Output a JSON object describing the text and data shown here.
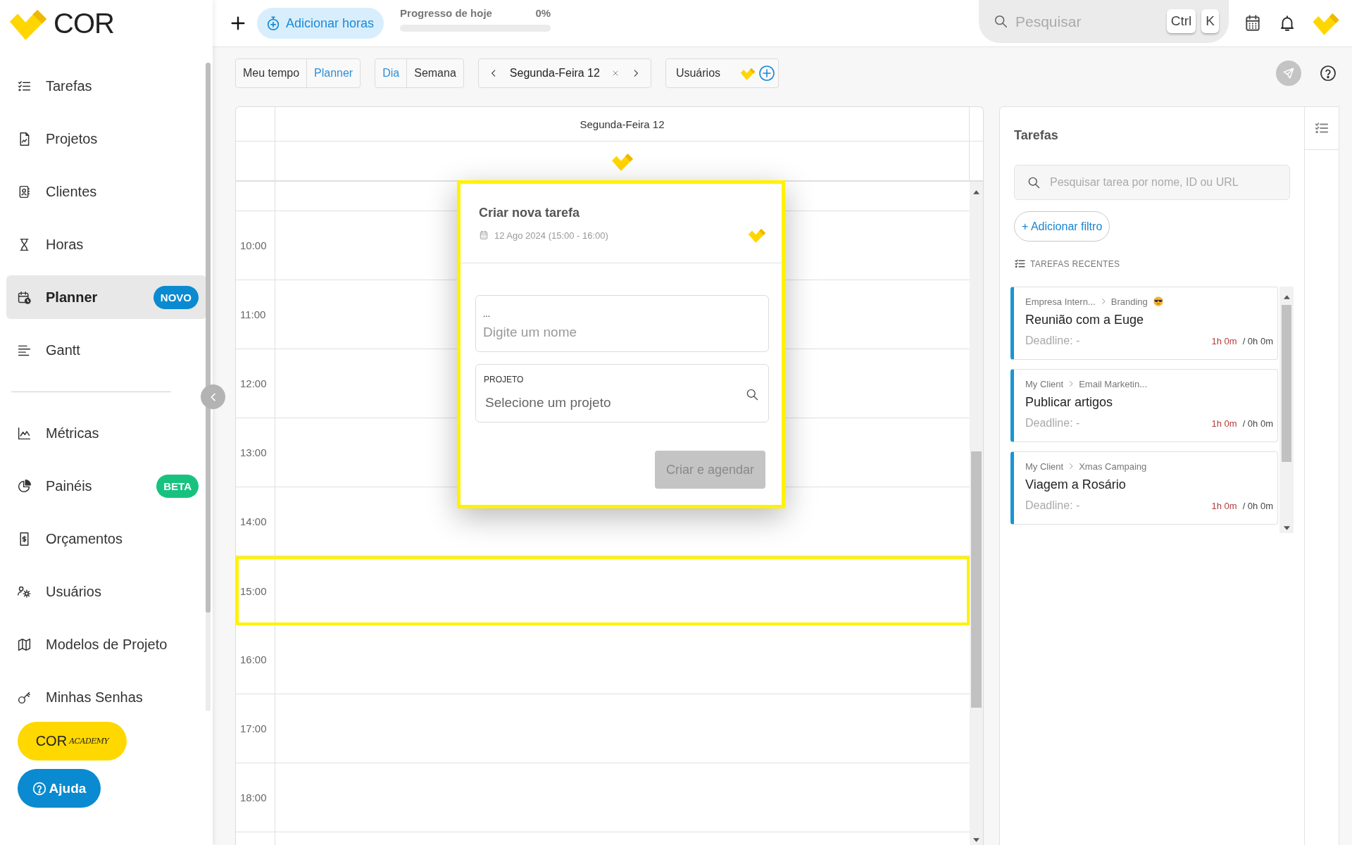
{
  "sidebar": {
    "brand": "COR",
    "nav_groups": [
      {
        "items": [
          {
            "label": "Tarefas",
            "selected": false
          },
          {
            "label": "Projetos",
            "selected": false
          },
          {
            "label": "Clientes",
            "selected": false
          },
          {
            "label": "Horas",
            "selected": false
          },
          {
            "label": "Planner",
            "selected": true,
            "badge": {
              "text": "NOVO",
              "color": "#0a8ad0"
            }
          },
          {
            "label": "Gantt",
            "selected": false
          }
        ]
      },
      {
        "items": [
          {
            "label": "Métricas",
            "selected": false
          },
          {
            "label": "Painéis",
            "selected": false,
            "badge": {
              "text": "BETA",
              "color": "#17c27f"
            }
          },
          {
            "label": "Orçamentos",
            "selected": false
          },
          {
            "label": "Usuários",
            "selected": false
          },
          {
            "label": "Modelos de Projeto",
            "selected": false
          },
          {
            "label": "Minhas Senhas",
            "selected": false
          }
        ]
      }
    ],
    "academy_button": {
      "brand": "COR",
      "word": "ACADEMY"
    },
    "help_button": {
      "label": "Ajuda"
    }
  },
  "top_bar": {
    "add_hours_button": {
      "label": "Adicionar horas"
    },
    "progress": {
      "label": "Progresso de hoje",
      "reading": "0%",
      "level": 0
    },
    "search": {
      "placeholder": "Pesquisar",
      "shortcut_keys": [
        "Ctrl",
        "K"
      ]
    }
  },
  "toolbar": {
    "view_tabs": [
      {
        "label": "Meu tempo",
        "selected": false
      },
      {
        "label": "Planner",
        "selected": true
      }
    ],
    "range_tabs": [
      {
        "label": "Dia",
        "selected": true
      },
      {
        "label": "Semana",
        "selected": false
      }
    ],
    "date_nav": {
      "label": "Segunda-Feira 12"
    },
    "users_filter": {
      "label": "Usuários"
    }
  },
  "calendar": {
    "day_header": "Segunda-Feira 12",
    "hours": [
      {
        "label": "10:00",
        "selected": false
      },
      {
        "label": "11:00",
        "selected": false
      },
      {
        "label": "12:00",
        "selected": false
      },
      {
        "label": "13:00",
        "selected": false
      },
      {
        "label": "14:00",
        "selected": false
      },
      {
        "label": "15:00",
        "selected": true
      },
      {
        "label": "16:00",
        "selected": false
      },
      {
        "label": "17:00",
        "selected": false
      },
      {
        "label": "18:00",
        "selected": false
      }
    ]
  },
  "new_task_dialog": {
    "title": "Criar nova tarefa",
    "date": "12 Ago 2024 (15:00 - 16:00)",
    "name_field": {
      "label": "...",
      "placeholder": "Digite um nome"
    },
    "project_field": {
      "label": "PROJETO",
      "placeholder": "Selecione um projeto"
    },
    "submit_button": {
      "label": "Criar e agendar",
      "disabled": true
    }
  },
  "tasks_panel": {
    "title": "Tarefas",
    "search": {
      "placeholder": "Pesquisar tarea por nome, ID ou URL"
    },
    "filter_button": {
      "label": "+ Adicionar filtro"
    },
    "recent_heading": "TAREFAS RECENTES",
    "tasks": [
      {
        "client": "Empresa Intern...",
        "project": "Branding",
        "emoji": true,
        "name": "Reunião com a Euge",
        "deadline": "Deadline: -",
        "logged": "1h 0m",
        "planned": "/ 0h 0m"
      },
      {
        "client": "My Client",
        "project": "Email Marketin...",
        "emoji": false,
        "name": "Publicar artigos",
        "deadline": "Deadline: -",
        "logged": "1h 0m",
        "planned": "/ 0h 0m"
      },
      {
        "client": "My Client",
        "project": "Xmas Campaing",
        "emoji": false,
        "name": "Viagem a Rosário",
        "deadline": "Deadline: -",
        "logged": "1h 0m",
        "planned": "/ 0h 0m"
      }
    ]
  }
}
